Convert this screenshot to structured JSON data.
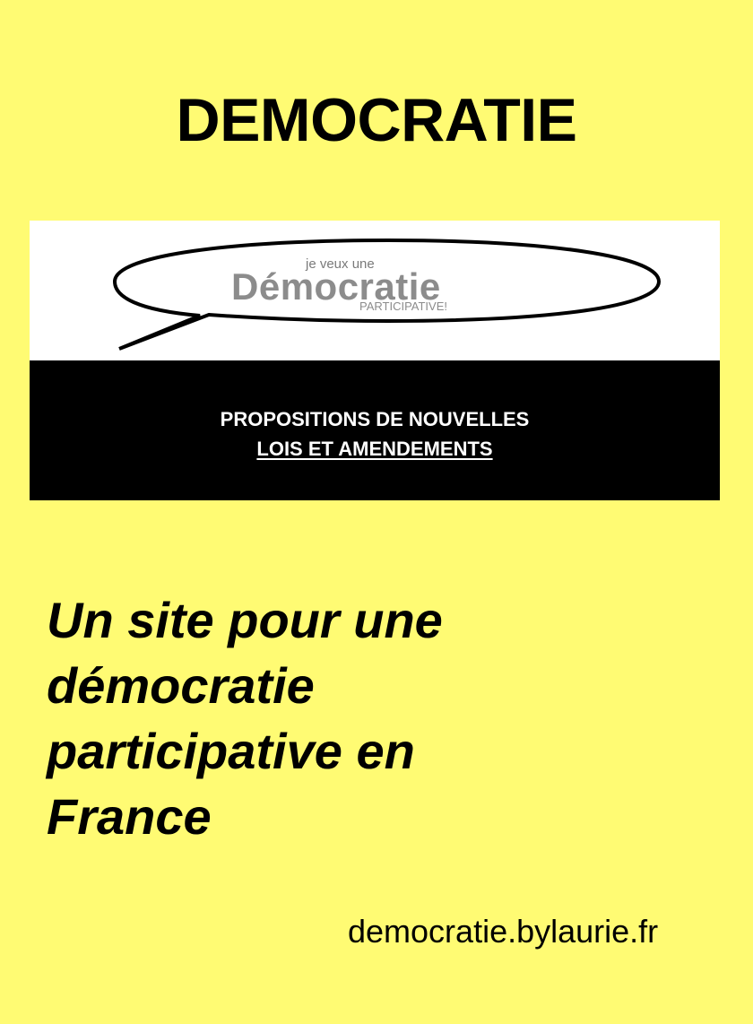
{
  "header": {
    "title": "DEMOCRATIE"
  },
  "banner": {
    "bubble_small": "je veux une",
    "bubble_main": "Démocratie",
    "bubble_sub": "PARTICIPATIVE!",
    "propositions_line1": "PROPOSITIONS DE NOUVELLES",
    "propositions_line2": "LOIS ET AMENDEMENTS"
  },
  "tagline": {
    "lines": [
      "Un site pour une",
      "démocratie",
      "participative en",
      "France"
    ]
  },
  "footer": {
    "url": "democratie.bylaurie.fr"
  },
  "colors": {
    "background": "#fffb73",
    "banner_dark": "#000000",
    "banner_light": "#ffffff",
    "logo_text": "#8c8c8c"
  }
}
